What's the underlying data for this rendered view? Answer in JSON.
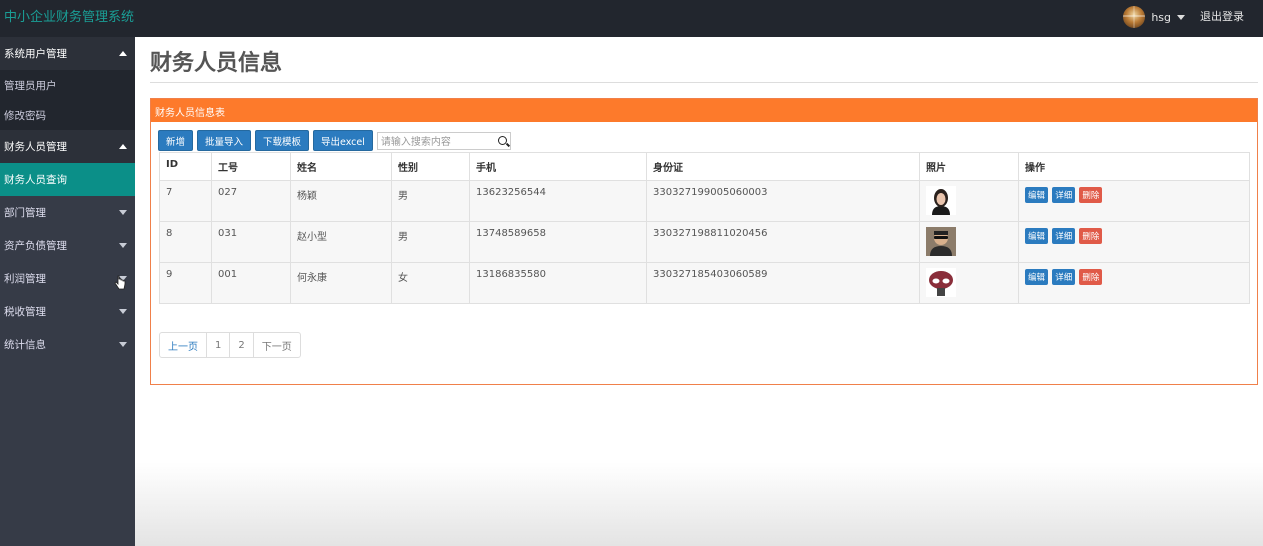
{
  "app": {
    "title": "中小企业财务管理系统",
    "user_name": "hsg",
    "logout_label": "退出登录"
  },
  "sidebar": {
    "groups": [
      {
        "label": "系统用户管理",
        "expanded": true,
        "items": [
          {
            "label": "管理员用户"
          },
          {
            "label": "修改密码"
          }
        ]
      },
      {
        "label": "财务人员管理",
        "expanded": true,
        "items": [
          {
            "label": "财务人员查询",
            "active": true
          }
        ]
      },
      {
        "label": "部门管理",
        "expanded": false
      },
      {
        "label": "资产负债管理",
        "expanded": false
      },
      {
        "label": "利润管理",
        "expanded": false
      },
      {
        "label": "税收管理",
        "expanded": false
      },
      {
        "label": "统计信息",
        "expanded": false
      }
    ]
  },
  "page": {
    "title": "财务人员信息",
    "panel_title": "财务人员信息表",
    "toolbar": {
      "add_label": "新增",
      "import_label": "批量导入",
      "download_template_label": "下载模板",
      "export_label": "导出excel",
      "search_placeholder": "请输入搜索内容"
    },
    "table": {
      "columns": [
        "ID",
        "工号",
        "姓名",
        "性别",
        "手机",
        "身份证",
        "照片",
        "操作"
      ],
      "rows": [
        {
          "id": "7",
          "emp_no": "027",
          "name": "杨颖",
          "gender": "男",
          "phone": "13623256544",
          "id_card": "330327199005060003",
          "photo": "woman-portrait"
        },
        {
          "id": "8",
          "emp_no": "031",
          "name": "赵小型",
          "gender": "男",
          "phone": "13748589658",
          "id_card": "330327198811020456",
          "photo": "man-sunglasses"
        },
        {
          "id": "9",
          "emp_no": "001",
          "name": "何永康",
          "gender": "女",
          "phone": "13186835580",
          "id_card": "330327185403060589",
          "photo": "cartoon-frog"
        }
      ],
      "actions": {
        "edit": "编辑",
        "detail": "详细",
        "delete": "删除"
      }
    },
    "pagination": {
      "prev": "上一页",
      "pages": [
        "1",
        "2"
      ],
      "next": "下一页"
    }
  },
  "colors": {
    "topbar": "#22262e",
    "brand": "#1a9e96",
    "sidebar": "#363b47",
    "sidebar_active": "#0b8f88",
    "panel_accent": "#fd7a2b",
    "primary_button": "#2b7bbf",
    "danger_button": "#e05a48"
  }
}
